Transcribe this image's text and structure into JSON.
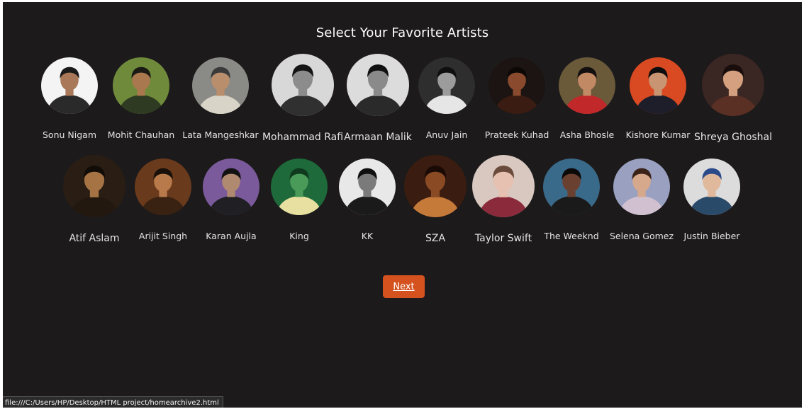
{
  "page": {
    "title": "Select Your Favorite Artists",
    "next_label": "Next",
    "status_url": "file:///C:/Users/HP/Desktop/HTML project/homearchive2.html"
  },
  "colors": {
    "background": "#1c1a1b",
    "accent": "#d5521f",
    "text": "#ffffff"
  },
  "artists": [
    {
      "name": "Sonu Nigam",
      "bg": "#f4f4f4",
      "skin": "#a97858",
      "cloth": "#2a2a2a",
      "hair": "#1a1a1a"
    },
    {
      "name": "Mohit Chauhan",
      "bg": "#6e8a3a",
      "skin": "#a9784e",
      "cloth": "#2f3a22",
      "hair": "#1b1a14"
    },
    {
      "name": "Lata Mangeshkar",
      "bg": "#8a8a86",
      "skin": "#b98e6c",
      "cloth": "#d8d4c8",
      "hair": "#3a3a3a"
    },
    {
      "name": "Mohammad Rafi",
      "bg": "#d8d8d8",
      "skin": "#8c8c8c",
      "cloth": "#303030",
      "hair": "#151515"
    },
    {
      "name": "Armaan Malik",
      "bg": "#dcdcdc",
      "skin": "#8a8a8a",
      "cloth": "#2a2a2a",
      "hair": "#111111"
    },
    {
      "name": "Anuv Jain",
      "bg": "#2e2e2e",
      "skin": "#9c9c9c",
      "cloth": "#e6e6e6",
      "hair": "#0f0f0f"
    },
    {
      "name": "Prateek Kuhad",
      "bg": "#1b1412",
      "skin": "#8a4a2e",
      "cloth": "#3a1c12",
      "hair": "#0c0806"
    },
    {
      "name": "Asha Bhosle",
      "bg": "#6a5a3a",
      "skin": "#c28a64",
      "cloth": "#c0282a",
      "hair": "#141010"
    },
    {
      "name": "Kishore Kumar",
      "bg": "#d94a22",
      "skin": "#c99472",
      "cloth": "#1e1e2a",
      "hair": "#0d0d0d"
    },
    {
      "name": "Shreya Ghoshal",
      "bg": "#3a2622",
      "skin": "#d4a080",
      "cloth": "#5a3024",
      "hair": "#1a0e0c"
    },
    {
      "name": "Atif Aslam",
      "bg": "#2a1e14",
      "skin": "#a67444",
      "cloth": "#22180f",
      "hair": "#120c08"
    },
    {
      "name": "Arijit Singh",
      "bg": "#6a3a1c",
      "skin": "#b87a4a",
      "cloth": "#3a2212",
      "hair": "#1a100a"
    },
    {
      "name": "Karan Aujla",
      "bg": "#7a5a9a",
      "skin": "#b08a70",
      "cloth": "#1f1f24",
      "hair": "#121212"
    },
    {
      "name": "King",
      "bg": "#1e6a3a",
      "skin": "#4a9a5a",
      "cloth": "#e8e0a0",
      "hair": "#0f3a1e"
    },
    {
      "name": "KK",
      "bg": "#e8e8e8",
      "skin": "#7a7a7a",
      "cloth": "#1a1a1a",
      "hair": "#101010"
    },
    {
      "name": "SZA",
      "bg": "#3a1c10",
      "skin": "#8a4a24",
      "cloth": "#c67a3a",
      "hair": "#1a0a06"
    },
    {
      "name": "Taylor Swift",
      "bg": "#d8c8c0",
      "skin": "#e6c0b0",
      "cloth": "#8a2a3a",
      "hair": "#6a4a3a"
    },
    {
      "name": "The Weeknd",
      "bg": "#3a6a8a",
      "skin": "#6a4030",
      "cloth": "#1a1a1a",
      "hair": "#0c0a08"
    },
    {
      "name": "Selena Gomez",
      "bg": "#9aa0c0",
      "skin": "#d6a88c",
      "cloth": "#d0c0d0",
      "hair": "#3a2218"
    },
    {
      "name": "Justin Bieber",
      "bg": "#dcdcdc",
      "skin": "#e0b89c",
      "cloth": "#2a4a6a",
      "hair": "#2a4a8a"
    }
  ]
}
